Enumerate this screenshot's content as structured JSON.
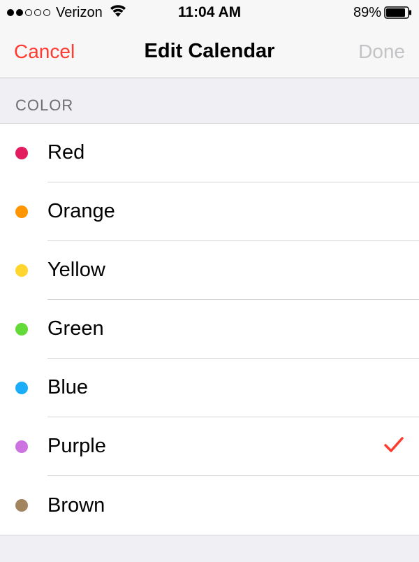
{
  "status_bar": {
    "carrier": "Verizon",
    "time": "11:04 AM",
    "battery_pct": "89%"
  },
  "nav": {
    "cancel": "Cancel",
    "title": "Edit Calendar",
    "done": "Done"
  },
  "section": {
    "header": "COLOR"
  },
  "colors": {
    "red": {
      "label": "Red",
      "hex": "#e31b5f"
    },
    "orange": {
      "label": "Orange",
      "hex": "#ff9500"
    },
    "yellow": {
      "label": "Yellow",
      "hex": "#ffd52e"
    },
    "green": {
      "label": "Green",
      "hex": "#63da38"
    },
    "blue": {
      "label": "Blue",
      "hex": "#1badf8"
    },
    "purple": {
      "label": "Purple",
      "hex": "#cc73e1"
    },
    "brown": {
      "label": "Brown",
      "hex": "#a2845e"
    }
  },
  "selected": "purple"
}
